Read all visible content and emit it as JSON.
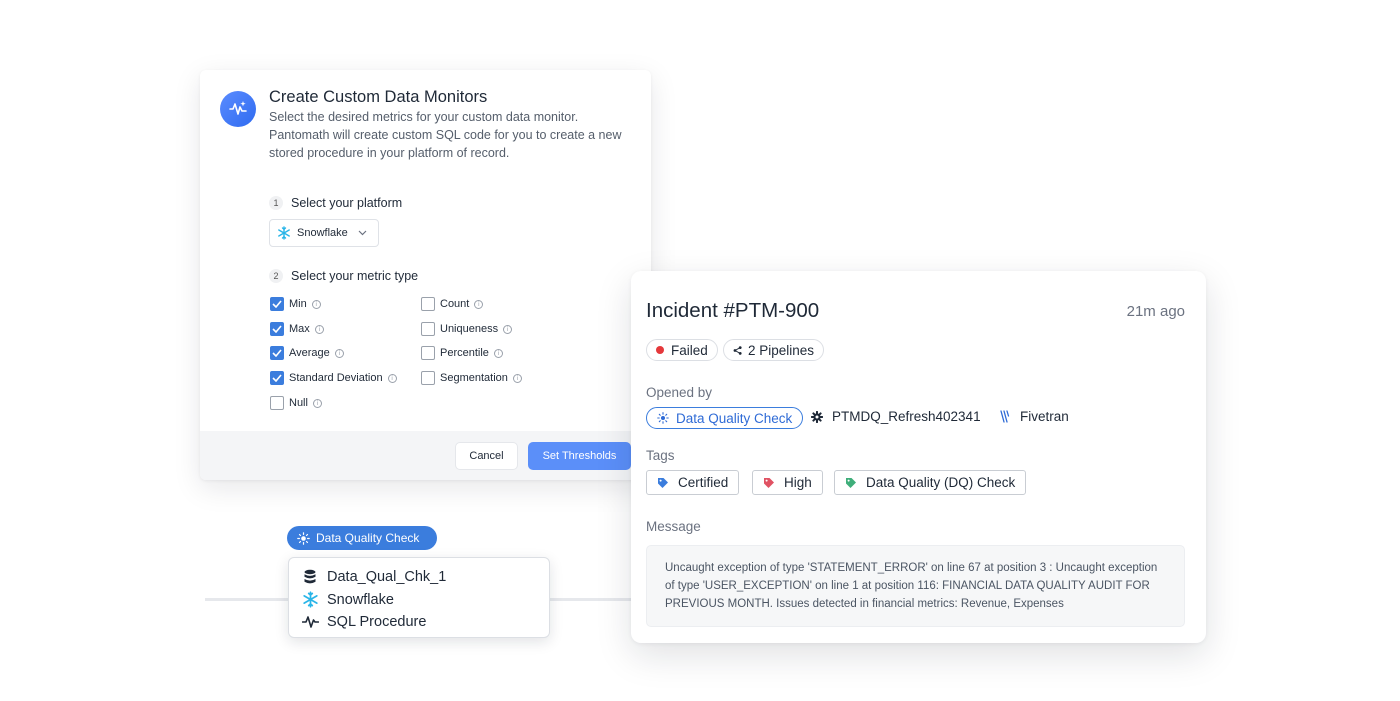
{
  "monitor_dialog": {
    "title": "Create Custom Data Monitors",
    "description": "Select the desired metrics for your custom data monitor. Pantomath will create custom SQL code for you to create a new stored procedure in your platform of record.",
    "step1": {
      "number": "1",
      "label": "Select your platform"
    },
    "platform_value": "Snowflake",
    "step2": {
      "number": "2",
      "label": "Select your metric type"
    },
    "metrics_left": [
      {
        "label": "Min",
        "checked": true
      },
      {
        "label": "Max",
        "checked": true
      },
      {
        "label": "Average",
        "checked": true
      },
      {
        "label": "Standard Deviation",
        "checked": true
      },
      {
        "label": "Null",
        "checked": false
      }
    ],
    "metrics_right": [
      {
        "label": "Count",
        "checked": false
      },
      {
        "label": "Uniqueness",
        "checked": false
      },
      {
        "label": "Percentile",
        "checked": false
      },
      {
        "label": "Segmentation",
        "checked": false
      }
    ],
    "info_glyph": "i",
    "cancel_label": "Cancel",
    "submit_label": "Set Thresholds"
  },
  "lineage_node": {
    "badge": "Data Quality Check",
    "rows": [
      {
        "icon": "database-icon",
        "label": "Data_Qual_Chk_1"
      },
      {
        "icon": "snowflake-icon",
        "label": "Snowflake"
      },
      {
        "icon": "pulse-icon",
        "label": "SQL Procedure"
      }
    ]
  },
  "incident": {
    "title": "Incident #PTM-900",
    "time": "21m ago",
    "status_label": "Failed",
    "pipelines_label": "2 Pipelines",
    "opened_by_label": "Opened by",
    "opened_by_chip": "Data Quality Check",
    "opened_by_job": "PTMDQ_Refresh402341",
    "opened_by_source": "Fivetran",
    "tags_label": "Tags",
    "tags": [
      {
        "label": "Certified",
        "color": "#3b7ddd"
      },
      {
        "label": "High",
        "color": "#e05263"
      },
      {
        "label": "Data Quality (DQ) Check",
        "color": "#3fae7a"
      }
    ],
    "message_label": "Message",
    "message": "Uncaught exception of type 'STATEMENT_ERROR' on line 67 at position 3 : Uncaught exception of type 'USER_EXCEPTION' on line 1 at position 116: FINANCIAL DATA QUALITY AUDIT FOR PREVIOUS MONTH. Issues detected in financial metrics: Revenue, Expenses"
  },
  "colors": {
    "accent_blue": "#3b7ddd",
    "button_blue": "#5b8ff9",
    "failed_red": "#e5383b",
    "snowflake_blue": "#29b5e8"
  }
}
